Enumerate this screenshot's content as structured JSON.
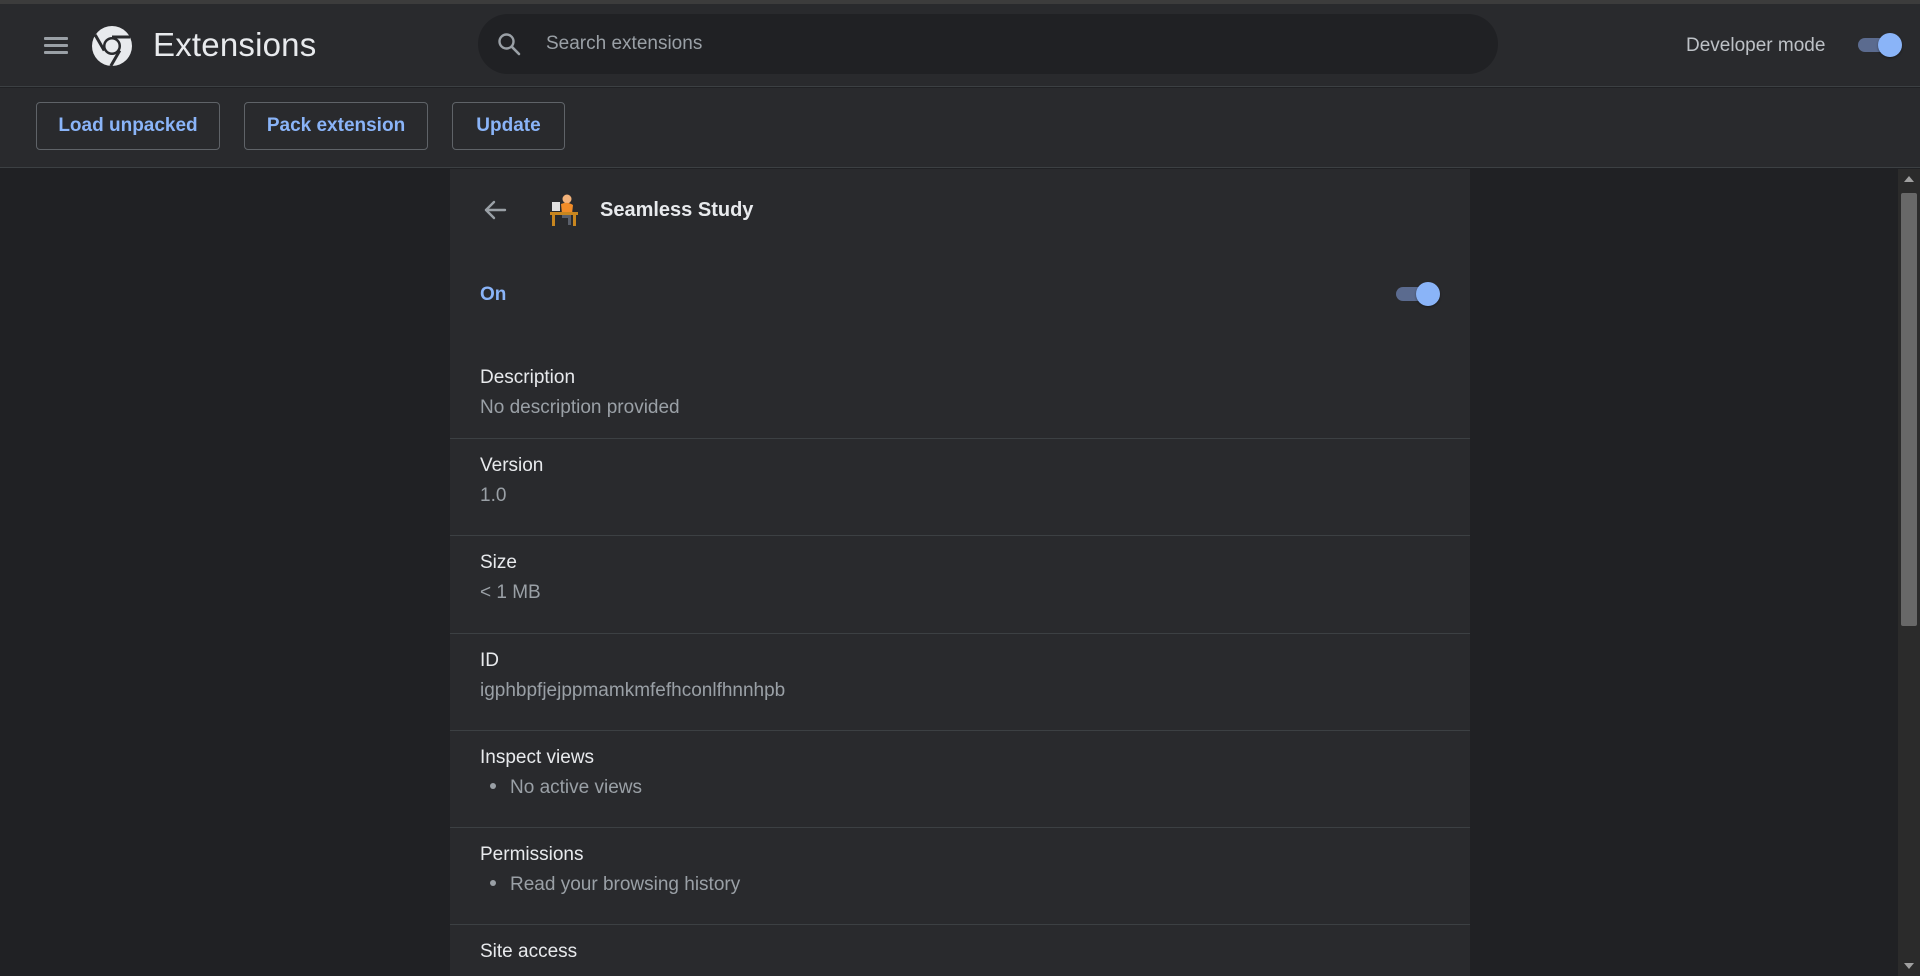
{
  "header": {
    "title": "Extensions",
    "search_placeholder": "Search extensions",
    "developer_mode_label": "Developer mode",
    "developer_mode_on": true
  },
  "toolbar": {
    "load_unpacked": "Load unpacked",
    "pack_extension": "Pack extension",
    "update": "Update"
  },
  "extension": {
    "name": "Seamless Study",
    "status_label": "On",
    "enabled": true,
    "sections": [
      {
        "title": "Description",
        "value": "No description provided"
      },
      {
        "title": "Version",
        "value": "1.0"
      },
      {
        "title": "Size",
        "value": "< 1 MB"
      },
      {
        "title": "ID",
        "value": "igphbpfjejppmamkmfefhconlfhnnhpb"
      },
      {
        "title": "Inspect views",
        "bullet": "No active views"
      },
      {
        "title": "Permissions",
        "bullet": "Read your browsing history"
      },
      {
        "title": "Site access"
      }
    ]
  },
  "colors": {
    "accent": "#8ab4f8",
    "background": "#202124",
    "surface": "#292a2d"
  },
  "icons": [
    "menu-icon",
    "chrome-logo-icon",
    "search-icon",
    "back-arrow-icon",
    "extension-icon",
    "scroll-up-icon",
    "scroll-down-icon"
  ]
}
